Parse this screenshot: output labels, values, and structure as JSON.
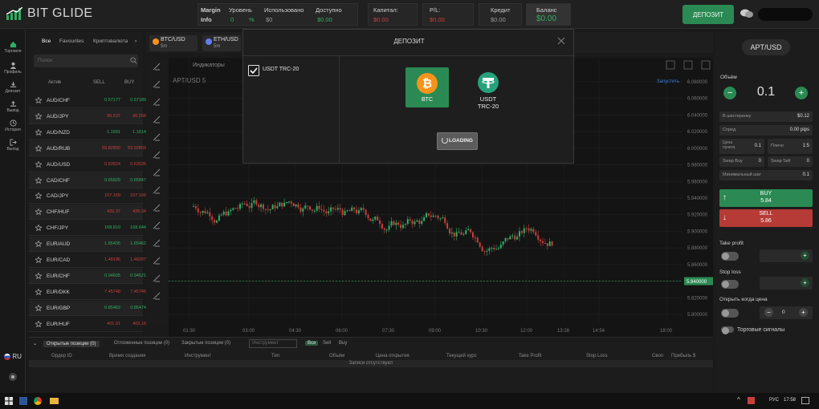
{
  "brand": {
    "name": "BIT GLIDE"
  },
  "header": {
    "margin_label": "Margin",
    "info_label": "Info",
    "stats": [
      {
        "label": "Уровень",
        "value": "0",
        "unit": "%"
      },
      {
        "label": "Использовано",
        "value": "$0"
      },
      {
        "label": "Доступно",
        "value": "$0.00"
      },
      {
        "label": "Капитал:",
        "value": "$0.00"
      },
      {
        "label": "P/L:",
        "value": "$0.00"
      },
      {
        "label": "Кредит",
        "value": "$0.00"
      },
      {
        "label": "Баланс",
        "value": "$0.00"
      }
    ],
    "deposit_button": "ДЕПОЗИТ"
  },
  "nav": [
    {
      "label": "Торговля",
      "icon": "home-icon"
    },
    {
      "label": "Профиль",
      "icon": "user-icon"
    },
    {
      "label": "Депозит",
      "icon": "download-icon"
    },
    {
      "label": "Вывод",
      "icon": "upload-icon"
    },
    {
      "label": "История",
      "icon": "history-icon"
    },
    {
      "label": "Выход",
      "icon": "logout-icon"
    }
  ],
  "language": "RU",
  "watchlist": {
    "tabs": [
      "Все",
      "Favourites",
      "Криптовалюта"
    ],
    "search_placeholder": "Поиск",
    "headers": {
      "asset": "Актив",
      "sell": "SELL",
      "buy": "BUY"
    },
    "rows": [
      {
        "symbol": "AUD/CHF",
        "sell": "0.57177",
        "buy": "0.57189",
        "dir": "green"
      },
      {
        "symbol": "AUD/JPY",
        "sell": "96.537",
        "buy": "96.558",
        "dir": "red"
      },
      {
        "symbol": "AUD/NZD",
        "sell": "1.1591",
        "buy": "1.1614",
        "dir": "green"
      },
      {
        "symbol": "AUD/RUB",
        "sell": "59.82800",
        "buy": "59.92803",
        "dir": "red"
      },
      {
        "symbol": "AUD/USD",
        "sell": "0.63524",
        "buy": "0.63535",
        "dir": "red"
      },
      {
        "symbol": "CAD/CHF",
        "sell": "0.65829",
        "buy": "0.65847",
        "dir": "green"
      },
      {
        "symbol": "CAD/JPY",
        "sell": "107.159",
        "buy": "107.169",
        "dir": "red"
      },
      {
        "symbol": "CHF/HUF",
        "sell": "426.37",
        "buy": "426.34",
        "dir": "red"
      },
      {
        "symbol": "CHF/JPY",
        "sell": "168.819",
        "buy": "168.844",
        "dir": "green"
      },
      {
        "symbol": "EUR/AUD",
        "sell": "1.65435",
        "buy": "1.65462",
        "dir": "green"
      },
      {
        "symbol": "EUR/CAD",
        "sell": "1.48196",
        "buy": "1.48207",
        "dir": "red"
      },
      {
        "symbol": "EUR/CHF",
        "sell": "0.94605",
        "buy": "0.94621",
        "dir": "green"
      },
      {
        "symbol": "EUR/DKK",
        "sell": "7.45748",
        "buy": "7.45745",
        "dir": "red"
      },
      {
        "symbol": "EUR/GBP",
        "sell": "0.85462",
        "buy": "0.85474",
        "dir": "green"
      },
      {
        "symbol": "EUR/HUF",
        "sell": "401.01",
        "buy": "403.18",
        "dir": "red"
      }
    ]
  },
  "chart": {
    "tabs": [
      {
        "name": "BTC/USD",
        "tf": "5m"
      },
      {
        "name": "ETH/USD",
        "tf": "5m"
      }
    ],
    "indicators_label": "Индикаторы",
    "symbol_label": "APT/USD 5",
    "realtime_label": "Запустить",
    "current_price": "5.840000",
    "y_ticks": [
      "6.080000",
      "6.060000",
      "6.040000",
      "6.020000",
      "6.000000",
      "5.980000",
      "5.960000",
      "5.940000",
      "5.920000",
      "5.900000",
      "5.880000",
      "5.860000",
      "5.840000",
      "5.820000",
      "5.800000"
    ],
    "x_ticks": [
      "01:30",
      "03:00",
      "04:30",
      "06:00",
      "07:30",
      "09:00",
      "10:30",
      "12:00",
      "13:28",
      "14:54",
      "18:00"
    ]
  },
  "order_panel": {
    "pair": "APT/USD",
    "volume_label": "Объём",
    "volume": "0.1",
    "fields": [
      {
        "label": "В шестеренку",
        "value": "$0.12"
      },
      {
        "label": "Спред",
        "value": "0.00 pips"
      }
    ],
    "grid": [
      {
        "label": "Цена пункта",
        "value": "0.1"
      },
      {
        "label": "Плечо",
        "value": "1:5"
      },
      {
        "label": "Swap Buy",
        "value": "0"
      },
      {
        "label": "Swap Sell",
        "value": "0"
      }
    ],
    "min_step_label": "Минимальный шаг",
    "min_step": "0.1",
    "buy_label": "BUY",
    "buy_price": "5.84",
    "sell_label": "SELL",
    "sell_price": "5.86",
    "take_profit_label": "Take profit",
    "stop_loss_label": "Stop loss",
    "open_at_price_label": "Открыть когда цена",
    "open_at_price_value": "0",
    "trade_signals_label": "Торговые сигналы"
  },
  "bottom": {
    "tabs": [
      "Открытые позиции (0)",
      "Отложенные позиции (0)",
      "Закрытые позиции (0)"
    ],
    "search_placeholder": "Инструмент",
    "filters": [
      "Все",
      "Sell",
      "Buy"
    ],
    "columns": [
      "Ордер ID",
      "Время создания",
      "Инструмент",
      "Тип",
      "Объём",
      "Цена открытия",
      "Текущий курс",
      "Take Profit",
      "Stop Loss",
      "Своп",
      "Прибыль $"
    ],
    "empty": "Записи отсутствуют"
  },
  "modal": {
    "title": "ДЕПОЗИТ",
    "method": "USDT TRC-20",
    "cards": [
      {
        "label": "BTC"
      },
      {
        "label_line1": "USDT",
        "label_line2": "TRC-20"
      }
    ],
    "loading": "LOADING"
  },
  "taskbar": {
    "lang": "РУС",
    "time": "17:58"
  },
  "colors": {
    "green": "#2b8a53",
    "red": "#b63a36",
    "bg": "#1a1a1a",
    "btc": "#f7931a",
    "usdt": "#26a17b"
  }
}
